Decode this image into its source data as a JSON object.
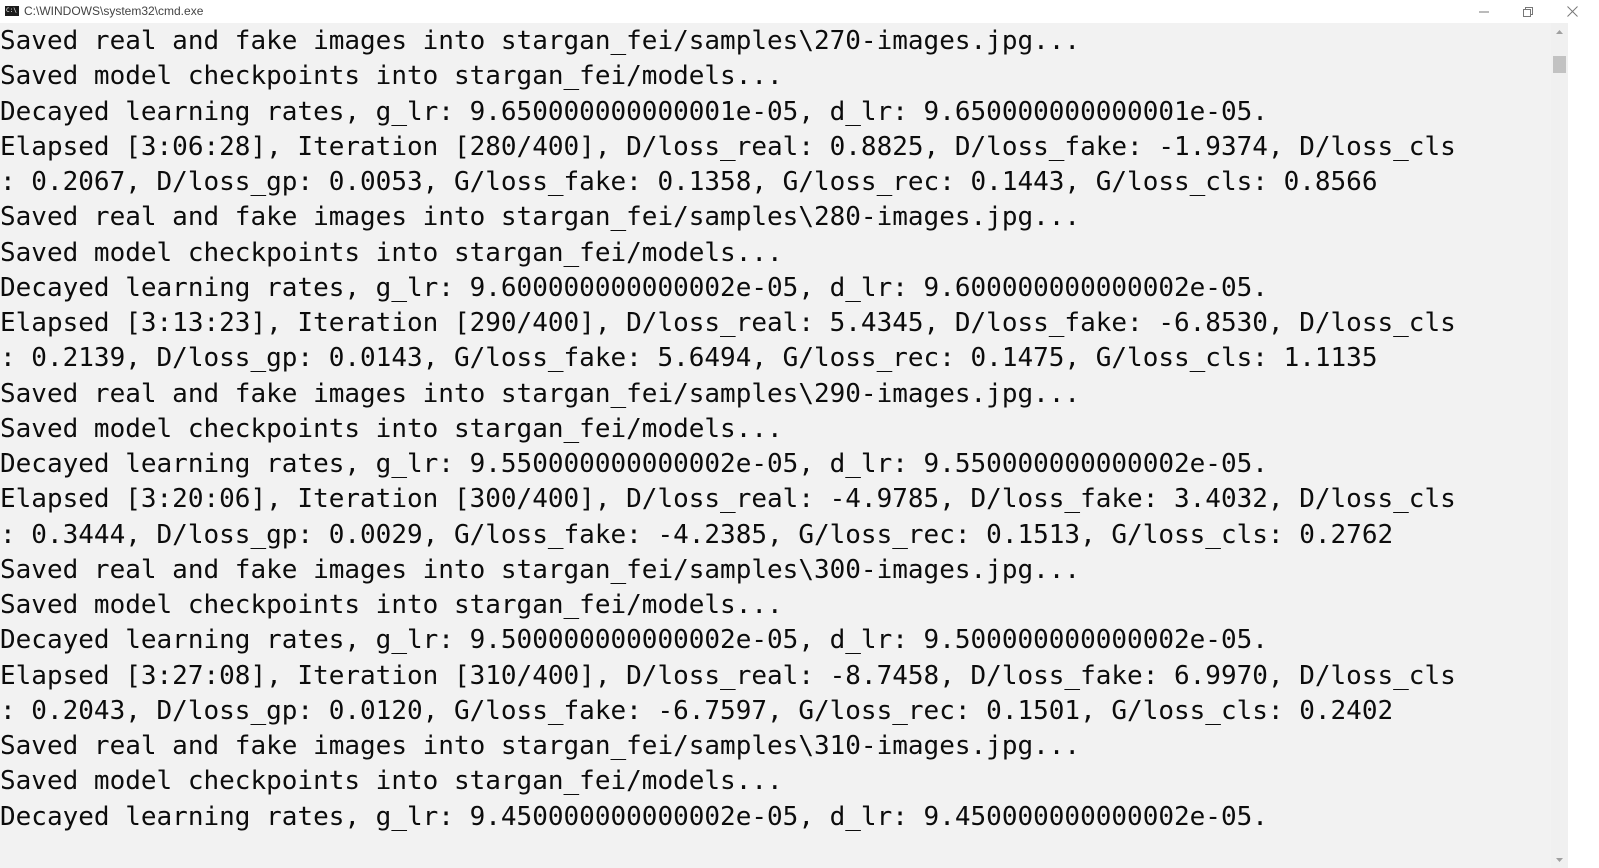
{
  "window": {
    "title": "C:\\WINDOWS\\system32\\cmd.exe",
    "icon": "cmd-icon",
    "icon_glyph": "C:\\",
    "controls": [
      "minimize-icon",
      "restore-icon",
      "close-icon"
    ]
  },
  "console": {
    "foreground": "#0c0c0c",
    "background": "#f2f2f2",
    "lines": [
      "Saved real and fake images into stargan_fei/samples\\270-images.jpg...",
      "Saved model checkpoints into stargan_fei/models...",
      "Decayed learning rates, g_lr: 9.650000000000001e-05, d_lr: 9.650000000000001e-05.",
      "Elapsed [3:06:28], Iteration [280/400], D/loss_real: 0.8825, D/loss_fake: -1.9374, D/loss_cls",
      ": 0.2067, D/loss_gp: 0.0053, G/loss_fake: 0.1358, G/loss_rec: 0.1443, G/loss_cls: 0.8566",
      "Saved real and fake images into stargan_fei/samples\\280-images.jpg...",
      "Saved model checkpoints into stargan_fei/models...",
      "Decayed learning rates, g_lr: 9.600000000000002e-05, d_lr: 9.600000000000002e-05.",
      "Elapsed [3:13:23], Iteration [290/400], D/loss_real: 5.4345, D/loss_fake: -6.8530, D/loss_cls",
      ": 0.2139, D/loss_gp: 0.0143, G/loss_fake: 5.6494, G/loss_rec: 0.1475, G/loss_cls: 1.1135",
      "Saved real and fake images into stargan_fei/samples\\290-images.jpg...",
      "Saved model checkpoints into stargan_fei/models...",
      "Decayed learning rates, g_lr: 9.550000000000002e-05, d_lr: 9.550000000000002e-05.",
      "Elapsed [3:20:06], Iteration [300/400], D/loss_real: -4.9785, D/loss_fake: 3.4032, D/loss_cls",
      ": 0.3444, D/loss_gp: 0.0029, G/loss_fake: -4.2385, G/loss_rec: 0.1513, G/loss_cls: 0.2762",
      "Saved real and fake images into stargan_fei/samples\\300-images.jpg...",
      "Saved model checkpoints into stargan_fei/models...",
      "Decayed learning rates, g_lr: 9.500000000000002e-05, d_lr: 9.500000000000002e-05.",
      "Elapsed [3:27:08], Iteration [310/400], D/loss_real: -8.7458, D/loss_fake: 6.9970, D/loss_cls",
      ": 0.2043, D/loss_gp: 0.0120, G/loss_fake: -6.7597, G/loss_rec: 0.1501, G/loss_cls: 0.2402",
      "Saved real and fake images into stargan_fei/samples\\310-images.jpg...",
      "Saved model checkpoints into stargan_fei/models...",
      "Decayed learning rates, g_lr: 9.450000000000002e-05, d_lr: 9.450000000000002e-05."
    ]
  },
  "scrollbar": {
    "position_fraction": 0.02
  }
}
